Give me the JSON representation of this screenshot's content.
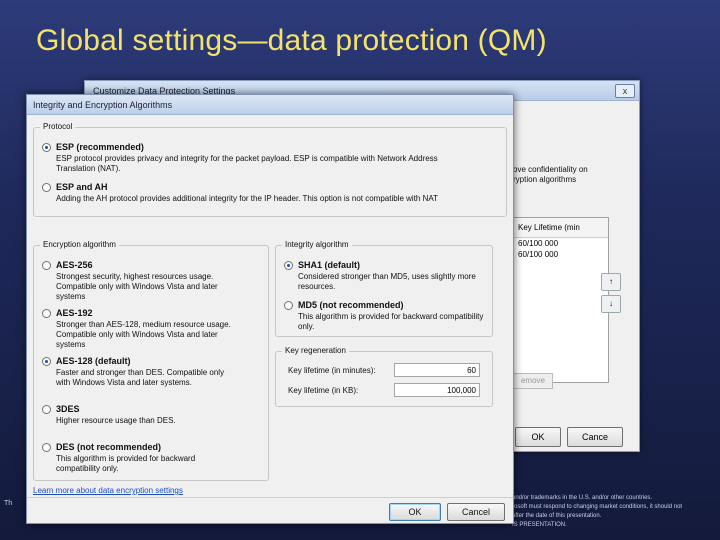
{
  "slide": {
    "title": "Global settings—data protection (QM)",
    "footer_left": "Th",
    "footer_right_lines": [
      "and/or trademarks in the U.S. and/or other countries.",
      "rosoft must respond to changing market conditions, it should not",
      "after the date of this presentation.",
      "IS PRESENTATION."
    ]
  },
  "back_window": {
    "title": "Customize Data Protection Settings",
    "close_label": "x",
    "text": "ove confidentiality on\nryption algorithms",
    "table_header": "Key Lifetime (min",
    "table_rows": [
      "60/100 000",
      "60/100 000"
    ],
    "up_label": "↑",
    "down_label": "↓",
    "remove_label": "emove",
    "ok_label": "OK",
    "cancel_label": "Cance"
  },
  "dialog": {
    "title": "Integrity and Encryption Algorithms",
    "protocol": {
      "label": "Protocol",
      "esp": {
        "title": "ESP (recommended)",
        "desc": "ESP protocol provides privacy and integrity for the packet payload. ESP is compatible with Network Address Translation (NAT).",
        "selected": true
      },
      "esp_ah": {
        "title": "ESP and AH",
        "desc": "Adding the AH protocol provides additional integrity for the IP header. This option is not compatible with NAT",
        "selected": false
      }
    },
    "encryption": {
      "label": "Encryption algorithm",
      "options": [
        {
          "title": "AES-256",
          "desc": "Strongest security, highest resources usage. Compatible only with Windows Vista and later systems",
          "selected": false
        },
        {
          "title": "AES-192",
          "desc": "Stronger than AES-128, medium resource usage. Compatible only with Windows Vista and later systems",
          "selected": false
        },
        {
          "title": "AES-128 (default)",
          "desc": "Faster and stronger than DES. Compatible only with Windows Vista and later systems.",
          "selected": true
        },
        {
          "title": "3DES",
          "desc": "Higher resource usage than DES.",
          "selected": false
        },
        {
          "title": "DES (not recommended)",
          "desc": "This algorithm is provided for backward compatibility only.",
          "selected": false
        }
      ]
    },
    "integrity": {
      "label": "Integrity algorithm",
      "options": [
        {
          "title": "SHA1 (default)",
          "desc": "Considered stronger than MD5, uses slightly more resources.",
          "selected": true
        },
        {
          "title": "MD5 (not recommended)",
          "desc": "This algorithm is provided for backward compatibility only.",
          "selected": false
        }
      ]
    },
    "key_regen": {
      "label": "Key regeneration",
      "minutes_label": "Key lifetime (in minutes):",
      "minutes_value": "60",
      "kb_label": "Key lifetime (in KB):",
      "kb_value": "100,000"
    },
    "link": "Learn more about data encryption settings",
    "ok_label": "OK",
    "cancel_label": "Cancel"
  }
}
